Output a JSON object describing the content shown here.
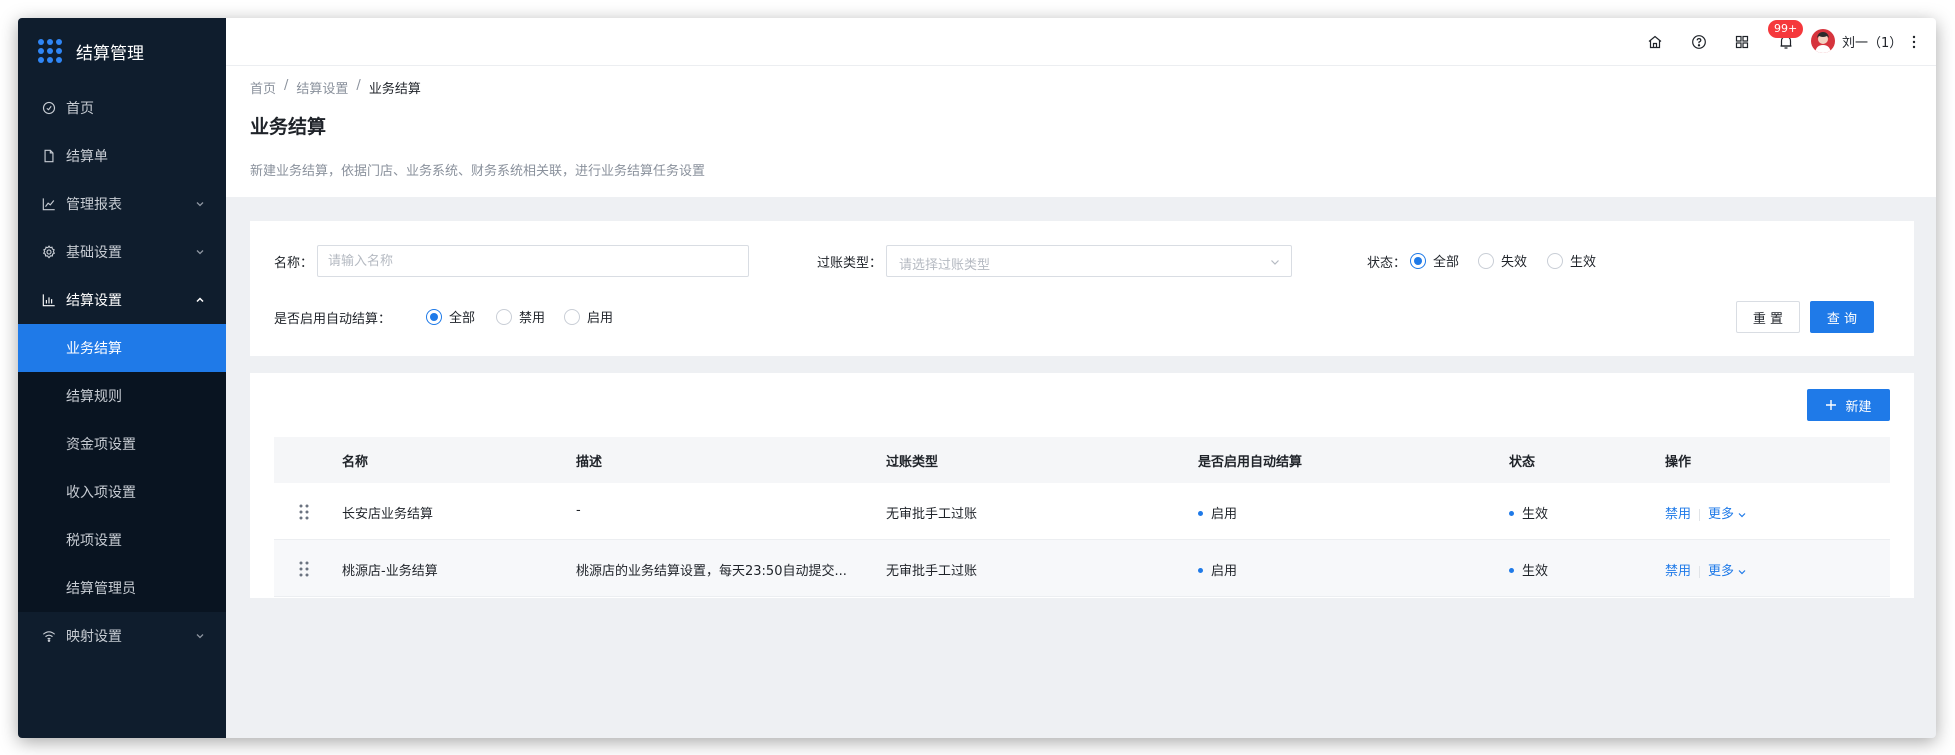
{
  "sidebar": {
    "title": "结算管理",
    "items": [
      {
        "label": "首页",
        "icon": "dashboard-icon"
      },
      {
        "label": "结算单",
        "icon": "file-icon"
      },
      {
        "label": "管理报表",
        "icon": "line-chart-icon"
      },
      {
        "label": "基础设置",
        "icon": "gear-icon"
      },
      {
        "label": "结算设置",
        "icon": "bar-chart-icon"
      },
      {
        "label": "映射设置",
        "icon": "wifi-icon"
      }
    ],
    "submenu": [
      {
        "label": "业务结算",
        "active": true
      },
      {
        "label": "结算规则"
      },
      {
        "label": "资金项设置"
      },
      {
        "label": "收入项设置"
      },
      {
        "label": "税项设置"
      },
      {
        "label": "结算管理员"
      }
    ]
  },
  "topbar": {
    "notification_count": "99+",
    "user_name": "刘一（1）"
  },
  "breadcrumb": {
    "home": "首页",
    "sep": "/",
    "parent": "结算设置",
    "current": "业务结算"
  },
  "page": {
    "title": "业务结算",
    "description": "新建业务结算，依据门店、业务系统、财务系统相关联，进行业务结算任务设置"
  },
  "filter": {
    "name_label": "名称：",
    "name_placeholder": "请输入名称",
    "type_label": "过账类型：",
    "type_placeholder": "请选择过账类型",
    "status_label": "状态：",
    "status_options": [
      "全部",
      "失效",
      "生效"
    ],
    "auto_label": "是否启用自动结算：",
    "auto_options": [
      "全部",
      "禁用",
      "启用"
    ],
    "reset_label": "重 置",
    "query_label": "查 询"
  },
  "table": {
    "new_button": "新建",
    "columns": [
      "名称",
      "描述",
      "过账类型",
      "是否启用自动结算",
      "状态",
      "操作"
    ],
    "rows": [
      {
        "name": "长安店业务结算",
        "desc": "-",
        "type": "无审批手工过账",
        "auto": "启用",
        "status": "生效",
        "action1": "禁用",
        "action2": "更多"
      },
      {
        "name": "桃源店-业务结算",
        "desc": "桃源店的业务结算设置，每天23:50自动提交...",
        "type": "无审批手工过账",
        "auto": "启用",
        "status": "生效",
        "action1": "禁用",
        "action2": "更多"
      }
    ]
  },
  "colors": {
    "sidebar_bg": "#0f1d2d",
    "accent": "#1f7ae8",
    "badge": "#f5383c"
  }
}
